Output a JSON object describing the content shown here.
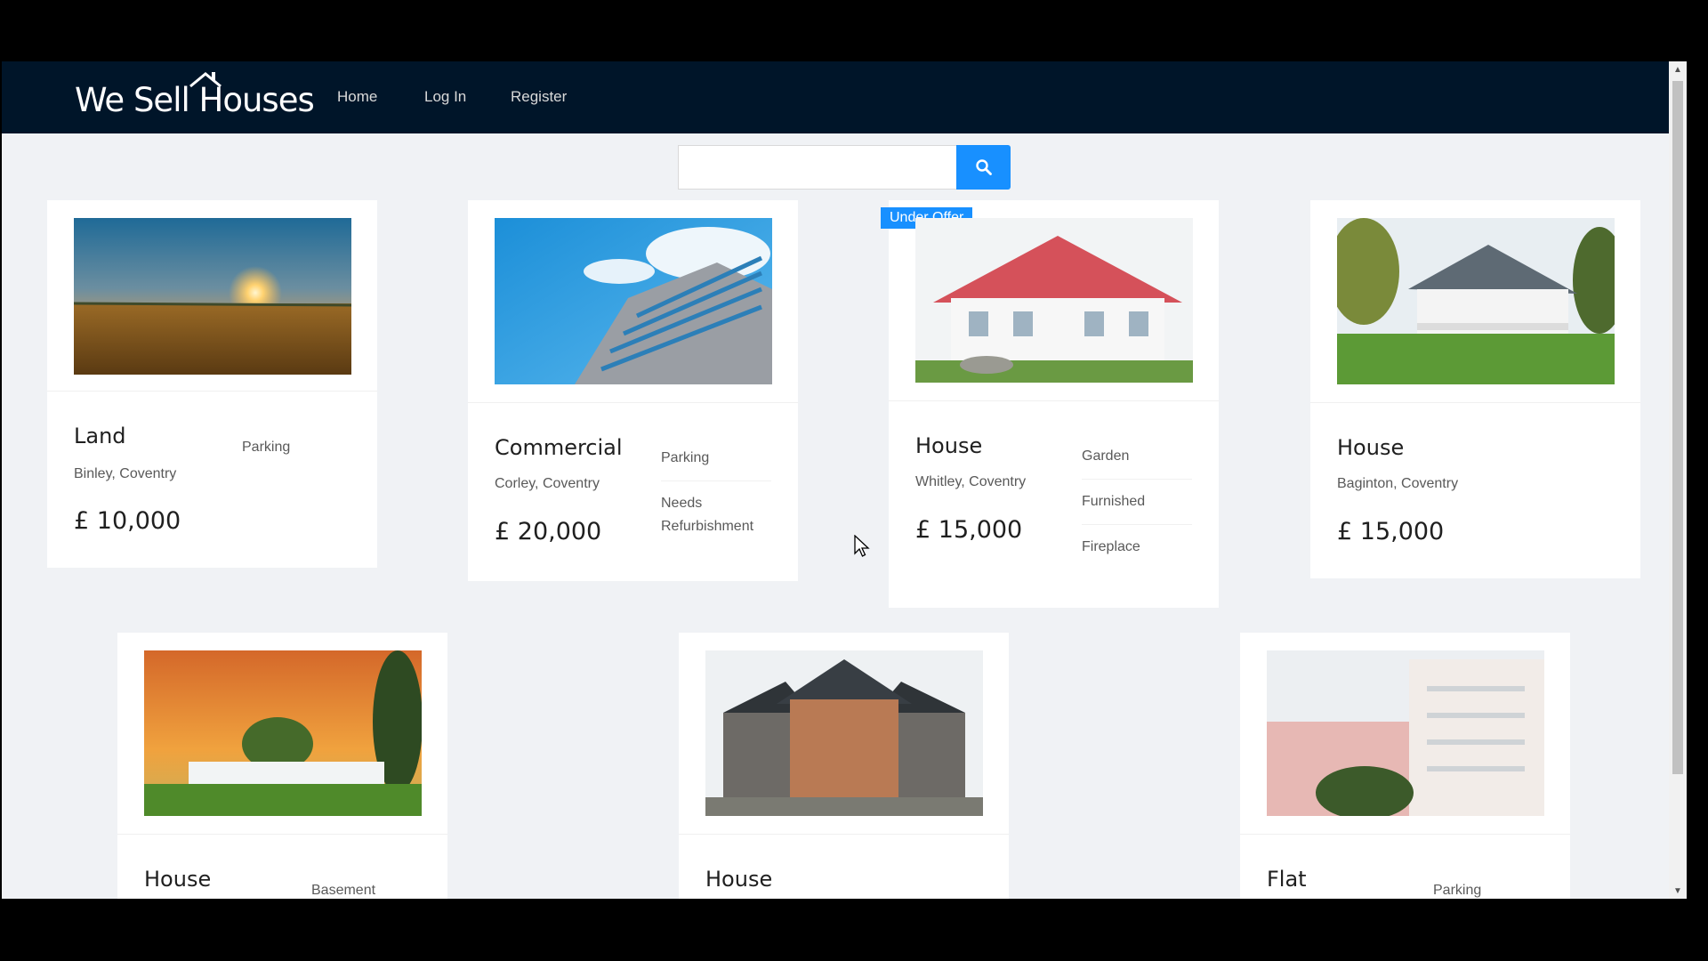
{
  "header": {
    "logo_text": "We Sell Houses",
    "nav": [
      {
        "label": "Home"
      },
      {
        "label": "Log In"
      },
      {
        "label": "Register"
      }
    ]
  },
  "search": {
    "placeholder": "",
    "icon": "search-icon"
  },
  "colors": {
    "navbar": "#001529",
    "accent": "#1890ff",
    "page_bg": "#f0f2f5",
    "card_bg": "#ffffff"
  },
  "listings": [
    {
      "type": "Land",
      "location": "Binley, Coventry",
      "price": "£ 10,000",
      "features": [
        "Parking"
      ],
      "badge": ""
    },
    {
      "type": "Commercial",
      "location": "Corley, Coventry",
      "price": "£ 20,000",
      "features": [
        "Parking",
        "Needs Refurbishment"
      ],
      "badge": ""
    },
    {
      "type": "House",
      "location": "Whitley, Coventry",
      "price": "£ 15,000",
      "features": [
        "Garden",
        "Furnished",
        "Fireplace"
      ],
      "badge": "Under Offer"
    },
    {
      "type": "House",
      "location": "Baginton, Coventry",
      "price": "£ 15,000",
      "features": [],
      "badge": ""
    },
    {
      "type": "House",
      "location": "",
      "price": "",
      "features": [
        "Basement"
      ],
      "badge": ""
    },
    {
      "type": "House",
      "location": "",
      "price": "",
      "features": [],
      "badge": ""
    },
    {
      "type": "Flat",
      "location": "",
      "price": "",
      "features": [
        "Parking"
      ],
      "badge": ""
    }
  ]
}
